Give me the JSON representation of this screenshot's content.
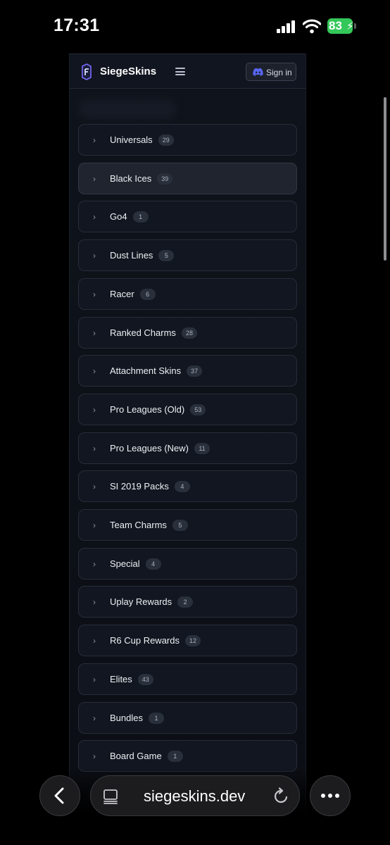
{
  "status_bar": {
    "time": "17:31",
    "battery": "83"
  },
  "header": {
    "brand": "SiegeSkins",
    "signin_label": "Sign in"
  },
  "categories": [
    {
      "label": "Universals",
      "count": "29"
    },
    {
      "label": "Black Ices",
      "count": "39"
    },
    {
      "label": "Go4",
      "count": "1"
    },
    {
      "label": "Dust Lines",
      "count": "5"
    },
    {
      "label": "Racer",
      "count": "6"
    },
    {
      "label": "Ranked Charms",
      "count": "28"
    },
    {
      "label": "Attachment Skins",
      "count": "37"
    },
    {
      "label": "Pro Leagues (Old)",
      "count": "53"
    },
    {
      "label": "Pro Leagues (New)",
      "count": "11"
    },
    {
      "label": "SI 2019 Packs",
      "count": "4"
    },
    {
      "label": "Team Charms",
      "count": "5"
    },
    {
      "label": "Special",
      "count": "4"
    },
    {
      "label": "Uplay Rewards",
      "count": "2"
    },
    {
      "label": "R6 Cup Rewards",
      "count": "12"
    },
    {
      "label": "Elites",
      "count": "43"
    },
    {
      "label": "Bundles",
      "count": "1"
    },
    {
      "label": "Board Game",
      "count": "1"
    }
  ],
  "browser": {
    "url": "siegeskins.dev"
  },
  "icons": {
    "logo": "siegeskins-logo-icon",
    "menu": "hamburger-menu-icon",
    "discord": "discord-icon",
    "chevron": "chevron-right-icon",
    "back": "chevron-left-icon",
    "reader": "reader-mode-icon",
    "reload": "reload-icon",
    "more": "ellipsis-icon"
  },
  "colors": {
    "discord": "#5865F2",
    "battery": "#34c759",
    "logo_accent": "#6b6bff"
  }
}
